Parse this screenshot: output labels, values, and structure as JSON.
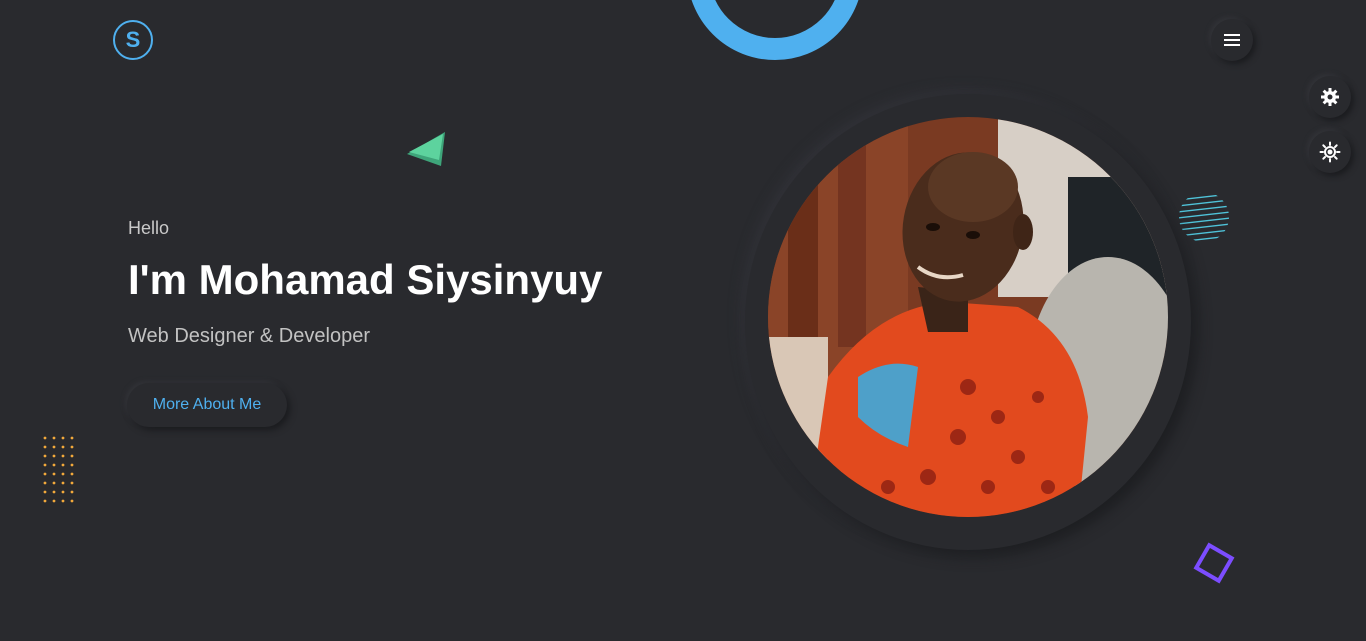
{
  "header": {
    "logo_letter": "S",
    "menu_icon": "hamburger-menu-icon"
  },
  "side_controls": [
    {
      "icon": "gear-icon"
    },
    {
      "icon": "sun-icon"
    }
  ],
  "hero": {
    "greeting": "Hello",
    "name": "I'm Mohamad Siysinyuy",
    "role": "Web Designer & Developer",
    "cta_label": "More About Me"
  },
  "colors": {
    "background": "#292a2e",
    "accent_blue": "#4fb0ef",
    "accent_green": "#5dd39e",
    "accent_orange": "#f2a93b",
    "accent_purple": "#7c4dff",
    "accent_teal": "#4fc3d9"
  }
}
